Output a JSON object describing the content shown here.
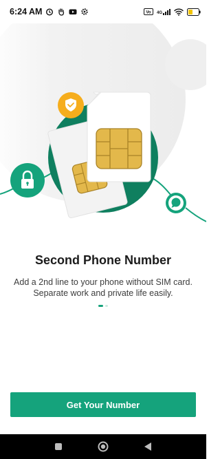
{
  "status_bar": {
    "time": "6:24 AM",
    "left_icons": [
      "alarm-icon",
      "hand-icon",
      "youtube-icon",
      "settings-icon"
    ],
    "right_icons": [
      "volte-icon",
      "signal-4g-icon",
      "wifi-icon",
      "battery-icon"
    ],
    "network_label": "4G"
  },
  "onboarding": {
    "title": "Second Phone Number",
    "subtitle": "Add a 2nd line to your phone without SIM card. Separate work and private life easily.",
    "page_indicator": {
      "current": 1,
      "total": 2
    },
    "illustration_icons": [
      "sim-card-icon",
      "shield-check-icon",
      "lock-icon",
      "chat-bubble-icon"
    ]
  },
  "cta": {
    "label": "Get Your Number"
  },
  "nav_bar": {
    "buttons": [
      "recents-button",
      "home-button",
      "back-button"
    ]
  },
  "colors": {
    "accent": "#15a37c",
    "dark_green": "#0f7f5f",
    "badge_orange": "#f6ad1c",
    "sim_chip": "#e3b84b"
  }
}
